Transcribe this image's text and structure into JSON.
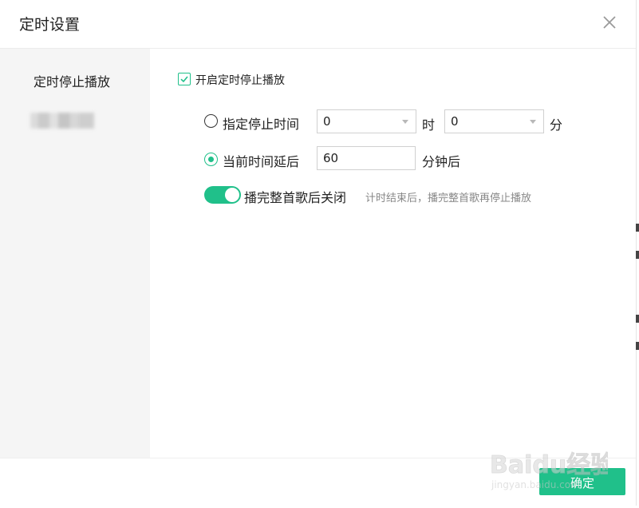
{
  "dialog": {
    "title": "定时设置",
    "close_icon": "close-icon"
  },
  "sidebar": {
    "items": [
      {
        "label": "定时停止播放",
        "active": true
      }
    ]
  },
  "content": {
    "enable_checkbox": {
      "label": "开启定时停止播放",
      "checked": true
    },
    "specific_time": {
      "label": "指定停止时间",
      "selected": false,
      "hour_value": "0",
      "hour_unit": "时",
      "minute_value": "0",
      "minute_unit": "分"
    },
    "delay": {
      "label": "当前时间延后",
      "selected": true,
      "value": "60",
      "unit": "分钟后"
    },
    "finish_song": {
      "label": "播完整首歌后关闭",
      "enabled": true,
      "hint": "计时结束后，播完整首歌再停止播放"
    }
  },
  "footer": {
    "confirm_label": "确定"
  },
  "watermark": {
    "line1": "Baidu经验",
    "line2": "jingyan.baidu.com"
  },
  "colors": {
    "accent": "#20c08a",
    "sidebar_bg": "#f5f5f5",
    "hint_text": "#888888"
  }
}
